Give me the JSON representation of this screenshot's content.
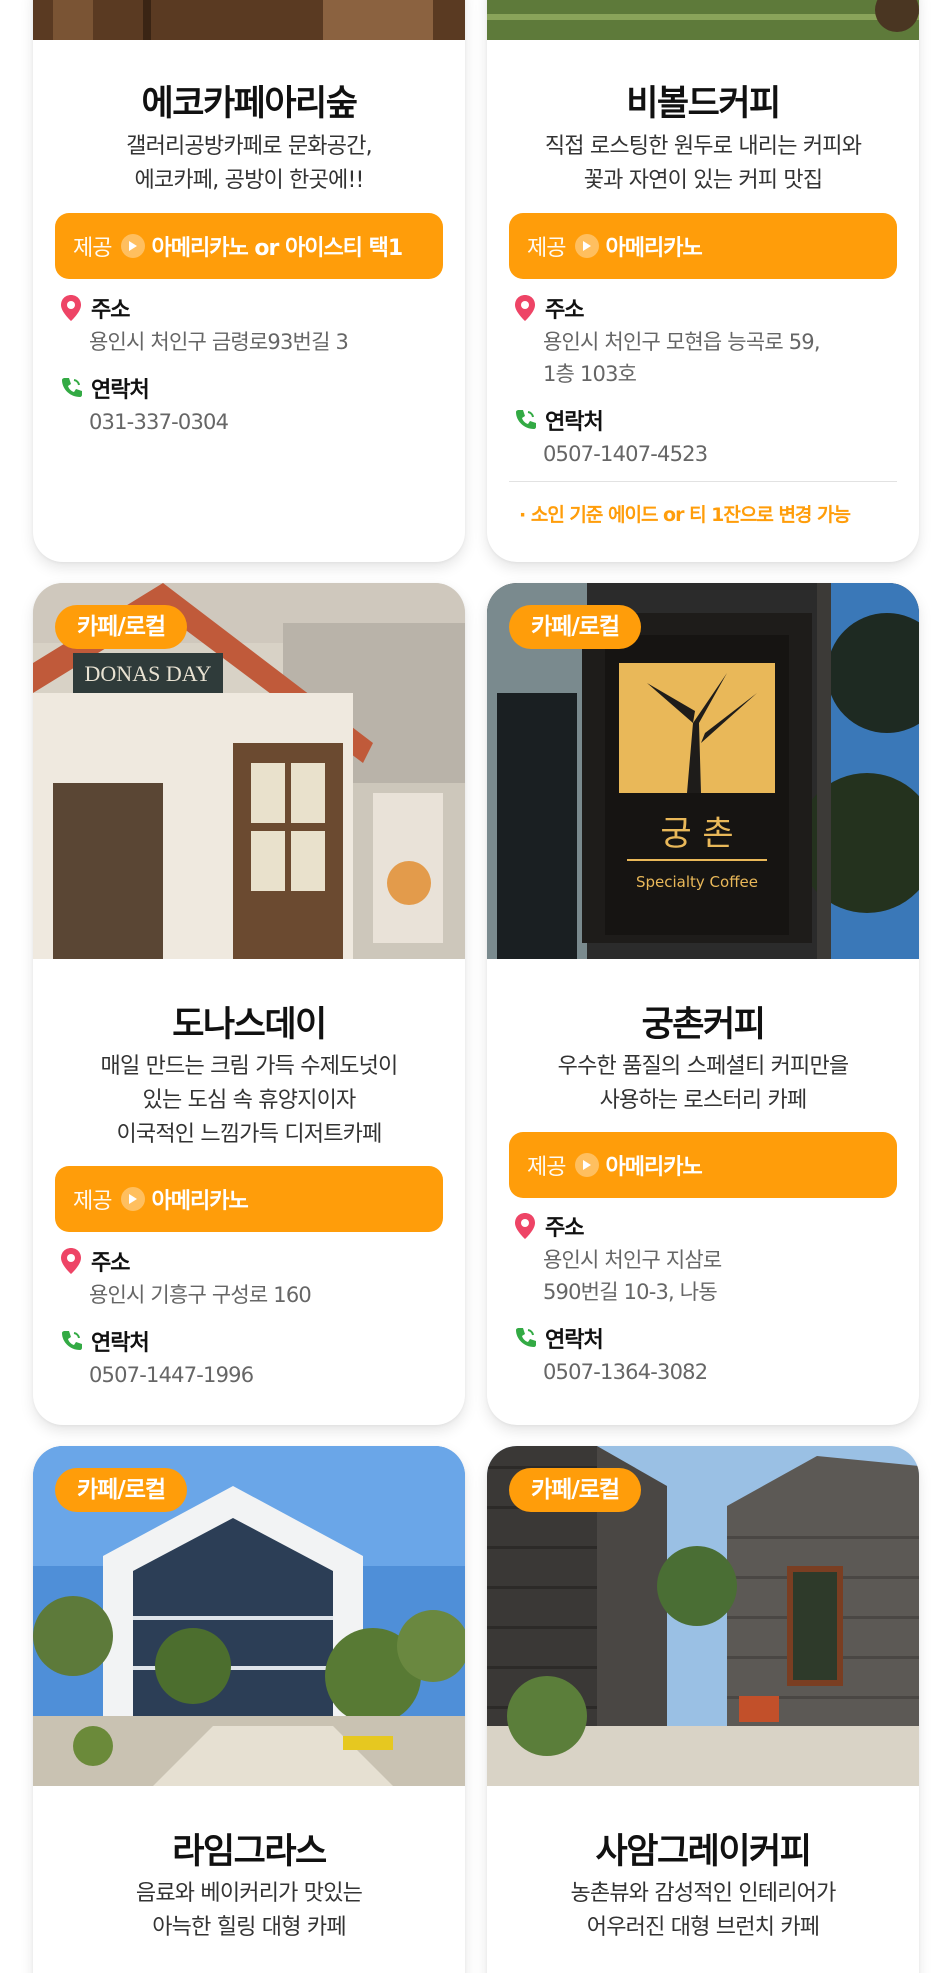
{
  "cards": [
    {
      "title": "에코카페아리숲",
      "desc": [
        "갤러리공방카페로 문화공간,",
        "에코카페, 공방이 한곳에!!"
      ],
      "offer_tag": "제공",
      "offer_text": "아메리카노 or 아이스티 택1",
      "address_label": "주소",
      "address": [
        "용인시 처인구 금령로93번길 3"
      ],
      "contact_label": "연락처",
      "contact": "031-337-0304"
    },
    {
      "title": "비볼드커피",
      "desc": [
        "직접 로스팅한 원두로 내리는 커피와",
        "꽃과 자연이 있는 커피 맛집"
      ],
      "offer_tag": "제공",
      "offer_text": "아메리카노",
      "address_label": "주소",
      "address": [
        "용인시 처인구 모현읍 능곡로 59,",
        "1층 103호"
      ],
      "contact_label": "연락처",
      "contact": "0507-1407-4523",
      "note": "· 소인 기준 에이드 or 티 1잔으로 변경 가능"
    },
    {
      "badge": "카페/로컬",
      "sign": "DONAS DAY",
      "title": "도나스데이",
      "desc": [
        "매일 만드는 크림 가득 수제도넛이",
        "있는 도심 속 휴양지이자",
        "이국적인 느낌가득 디저트카페"
      ],
      "offer_tag": "제공",
      "offer_text": "아메리카노",
      "address_label": "주소",
      "address": [
        "용인시 기흥구 구성로 160"
      ],
      "contact_label": "연락처",
      "contact": "0507-1447-1996"
    },
    {
      "badge": "카페/로컬",
      "sign": "궁 촌",
      "sign_sub": "Specialty Coffee",
      "title": "궁촌커피",
      "desc": [
        "우수한 품질의 스페셜티 커피만을",
        "사용하는 로스터리 카페"
      ],
      "offer_tag": "제공",
      "offer_text": "아메리카노",
      "address_label": "주소",
      "address": [
        "용인시 처인구 지삼로",
        "590번길 10-3, 나동"
      ],
      "contact_label": "연락처",
      "contact": "0507-1364-3082"
    },
    {
      "badge": "카페/로컬",
      "title": "라임그라스",
      "desc": [
        "음료와 베이커리가 맛있는",
        "아늑한 힐링 대형 카페"
      ]
    },
    {
      "badge": "카페/로컬",
      "title": "사암그레이커피",
      "desc": [
        "농촌뷰와 감성적인 인테리어가",
        "어우러진 대형 브런치 카페"
      ]
    }
  ],
  "colors": {
    "accent": "#ff9d0a",
    "pin": "#ee4466",
    "phone": "#33aa44"
  },
  "icons": [
    "location-pin-icon",
    "phone-icon",
    "arrow-circle-icon"
  ]
}
